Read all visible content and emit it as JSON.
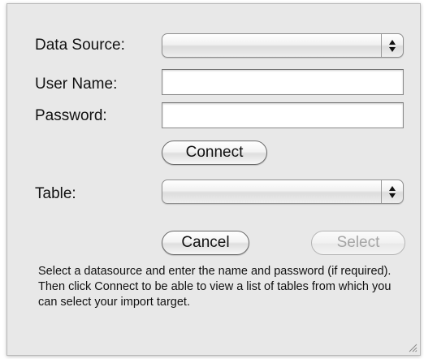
{
  "dialog": {
    "data_source_label": "Data Source:",
    "user_name_label": "User Name:",
    "password_label": "Password:",
    "table_label": "Table:",
    "data_source_value": "",
    "user_name_value": "",
    "password_value": "",
    "table_value": "",
    "connect_label": "Connect",
    "cancel_label": "Cancel",
    "select_label": "Select",
    "help_text": "Select a datasource and enter the name and password (if required).  Then click Connect to be able to view a list of tables from which you can select your import target."
  },
  "icons": {
    "stepper": "up-down-arrows-icon",
    "resize": "resize-grip-icon"
  }
}
